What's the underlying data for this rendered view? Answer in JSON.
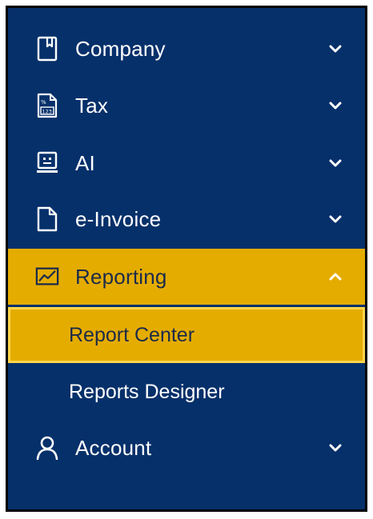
{
  "menu": {
    "items": [
      {
        "label": "Company",
        "icon": "bookmark-book-icon",
        "expanded": false
      },
      {
        "label": "Tax",
        "icon": "tax-form-icon",
        "expanded": false
      },
      {
        "label": "AI",
        "icon": "robot-screen-icon",
        "expanded": false
      },
      {
        "label": "e-Invoice",
        "icon": "document-icon",
        "expanded": false
      },
      {
        "label": "Reporting",
        "icon": "line-chart-icon",
        "expanded": true
      },
      {
        "label": "Account",
        "icon": "user-icon",
        "expanded": false
      }
    ],
    "reporting_subitems": [
      {
        "label": "Report Center",
        "selected": true
      },
      {
        "label": "Reports Designer",
        "selected": false
      }
    ]
  },
  "colors": {
    "background": "#06306a",
    "active": "#e5ac00",
    "selected_border": "#ffd54a",
    "text_light": "#ffffff",
    "text_dark": "#1c2b4a"
  }
}
